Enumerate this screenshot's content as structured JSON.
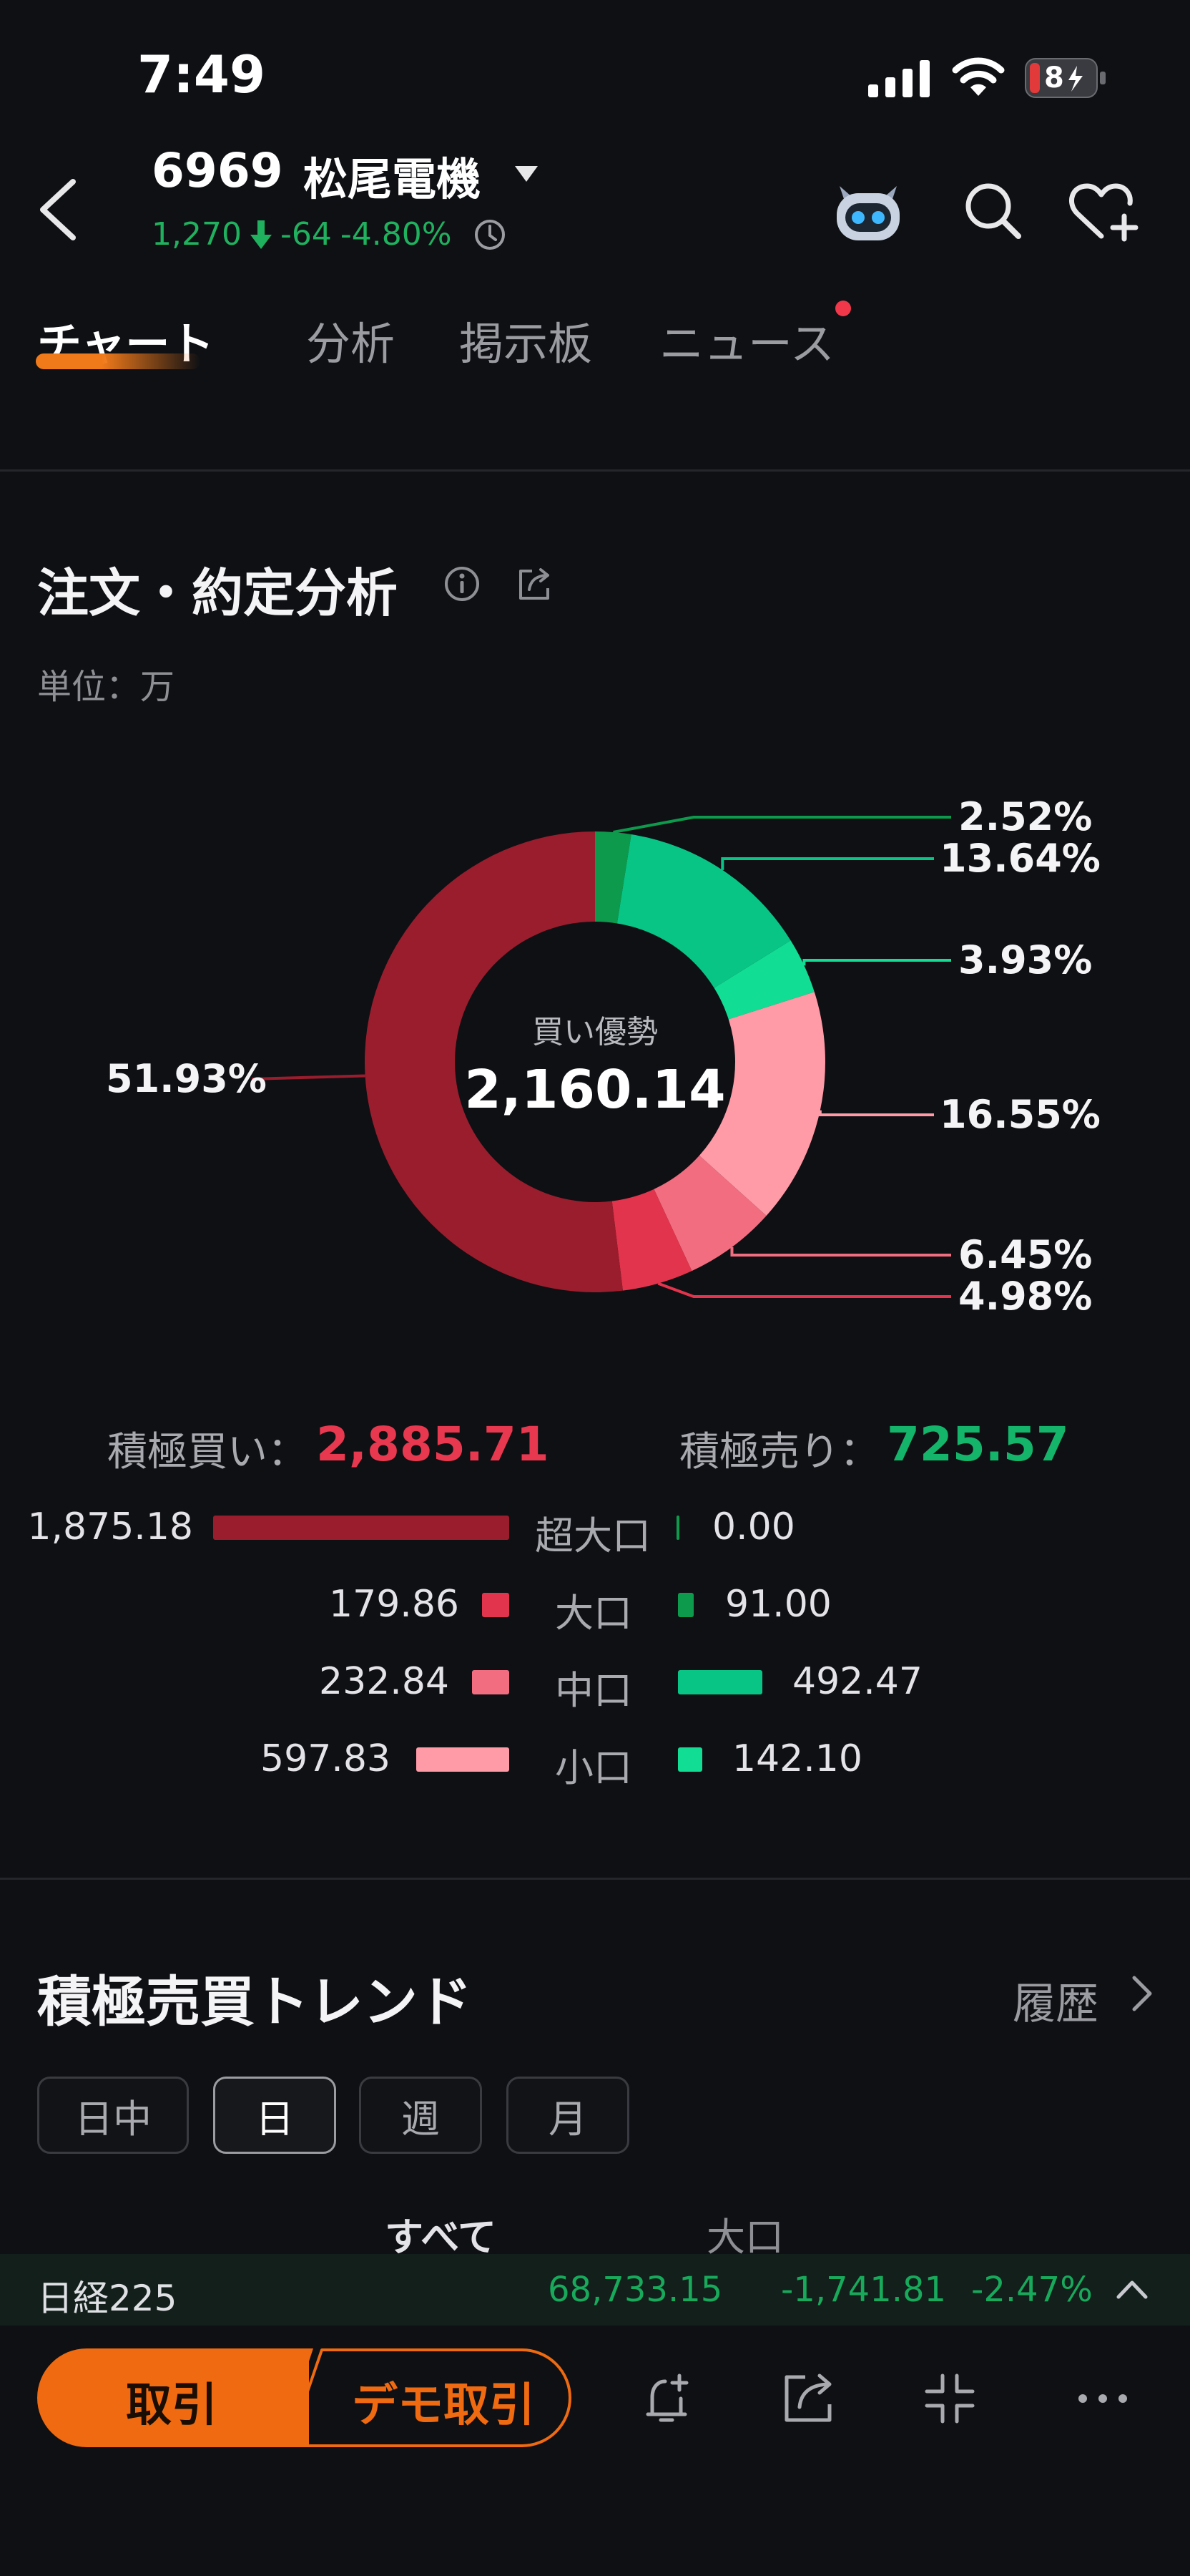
{
  "status_bar": {
    "time": "7:49",
    "battery": "8"
  },
  "header": {
    "code": "6969",
    "name": "松尾電機",
    "price": "1,270",
    "change": "-64",
    "change_pct": "-4.80%"
  },
  "tabs": [
    {
      "label": "チャート",
      "active": true
    },
    {
      "label": "分析",
      "active": false
    },
    {
      "label": "掲示板",
      "active": false
    },
    {
      "label": "ニュース",
      "active": false,
      "badge": true
    }
  ],
  "order_analysis": {
    "title": "注文・約定分析",
    "unit": "単位：万",
    "center_label": "買い優勢",
    "center_value": "2,160.14",
    "buy_label": "積極買い：",
    "buy_total": "2,885.71",
    "sell_label": "積極売り：",
    "sell_total": "725.57",
    "rows": [
      {
        "buy": "1,875.18",
        "label": "超大口",
        "sell": "0.00"
      },
      {
        "buy": "179.86",
        "label": "大口",
        "sell": "91.00"
      },
      {
        "buy": "232.84",
        "label": "中口",
        "sell": "492.47"
      },
      {
        "buy": "597.83",
        "label": "小口",
        "sell": "142.10"
      }
    ]
  },
  "chart_data": {
    "type": "pie",
    "slices": [
      {
        "label": "2.52%",
        "value": 2.52,
        "color": "#0e9a4c"
      },
      {
        "label": "13.64%",
        "value": 13.64,
        "color": "#08c585"
      },
      {
        "label": "3.93%",
        "value": 3.93,
        "color": "#12dd94"
      },
      {
        "label": "16.55%",
        "value": 16.55,
        "color": "#ff9aa7"
      },
      {
        "label": "6.45%",
        "value": 6.45,
        "color": "#f26d7f"
      },
      {
        "label": "4.98%",
        "value": 4.98,
        "color": "#e2344c"
      },
      {
        "label": "51.93%",
        "value": 51.93,
        "color": "#9a1d2d"
      }
    ]
  },
  "trend": {
    "title": "積極売買トレンド",
    "history": "履歴",
    "periods": [
      {
        "label": "日中",
        "active": false
      },
      {
        "label": "日",
        "active": true
      },
      {
        "label": "週",
        "active": false
      },
      {
        "label": "月",
        "active": false
      }
    ],
    "subtabs": [
      {
        "label": "すべて",
        "active": true
      },
      {
        "label": "大口",
        "active": false
      }
    ]
  },
  "index_bar": {
    "name": "日経225",
    "value": "68,733.15",
    "change": "-1,741.81",
    "change_pct": "-2.47%"
  },
  "bottom_bar": {
    "trade": "取引",
    "demo": "デモ取引"
  },
  "colors": {
    "accent": "#ef6a10",
    "up": "#e8384f",
    "down": "#14b46a"
  }
}
